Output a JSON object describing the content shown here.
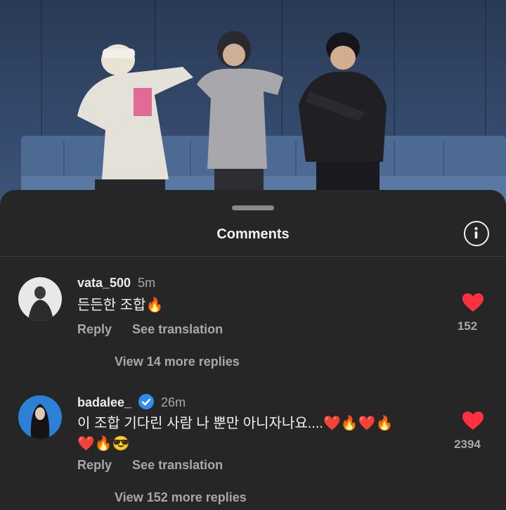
{
  "sheet": {
    "title": "Comments",
    "info_icon": "info-icon"
  },
  "comments": [
    {
      "username": "vata_500",
      "time": "5m",
      "text": "든든한 조합🔥",
      "reply_label": "Reply",
      "translate_label": "See translation",
      "likes": "152",
      "view_replies": "View 14 more replies",
      "verified": false
    },
    {
      "username": "badalee_",
      "time": "26m",
      "text_line1": "이 조합 기다린 사람 나 뿐만 아니자나요....❤️🔥❤️🔥",
      "text_line2": "❤️🔥😎",
      "reply_label": "Reply",
      "translate_label": "See translation",
      "likes": "2394",
      "view_replies": "View 152 more replies",
      "verified": true
    }
  ],
  "colors": {
    "background": "#262626",
    "heart": "#ff3040",
    "verified": "#2f8cf0",
    "muted_text": "#a8a8a8"
  }
}
